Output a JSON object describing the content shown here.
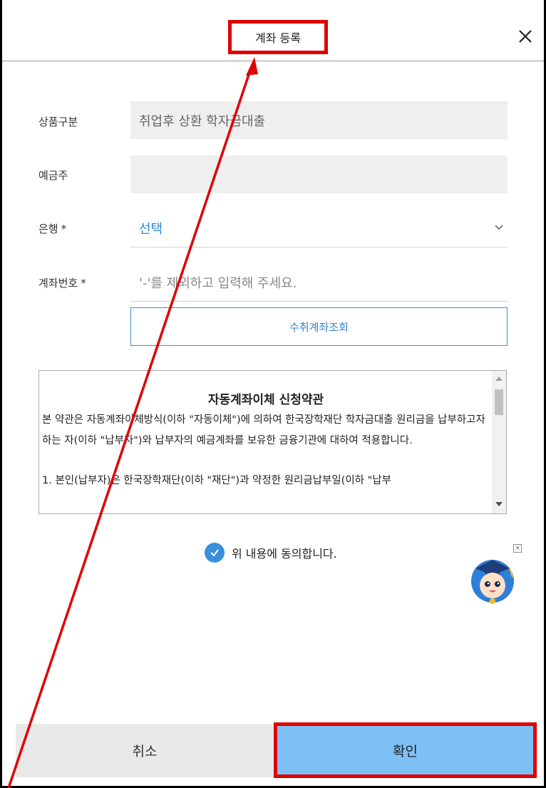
{
  "dialog": {
    "title": "계좌 등록",
    "close_icon": "close-icon"
  },
  "form": {
    "product": {
      "label": "상품구분",
      "value": "취업후 상환 학자금대출"
    },
    "holder": {
      "label": "예금주",
      "value": ""
    },
    "bank": {
      "label": "은행",
      "required_mark": "*",
      "value": "선택"
    },
    "account": {
      "label": "계좌번호",
      "required_mark": "*",
      "placeholder": "'-'를 제외하고 입력해 주세요."
    },
    "lookup_button": "수취계좌조회"
  },
  "terms": {
    "title": "자동계좌이체 신청약관",
    "body": "본 약관은 자동계좌이체방식(이하 \"자동이체\")에 의하여 한국장학재단 학자금대출 원리금을 납부하고자 하는 자(이하 \"납부자\")와 납부자의 예금계좌를 보유한 금융기관에 대하여 적용합니다.",
    "item1": "1.  본인(납부자)은 한국장학재단(이하 \"재단\")과 약정한 원리금납부일(이하 \"납부"
  },
  "agree": {
    "label": "위 내용에 동의합니다.",
    "checked": true,
    "check_color": "#3a8fdc"
  },
  "footer": {
    "cancel_label": "취소",
    "confirm_label": "확인",
    "confirm_color": "#7ebff6",
    "cancel_color": "#e9e9e9"
  },
  "annotation": {
    "highlight_color": "#e00000"
  }
}
